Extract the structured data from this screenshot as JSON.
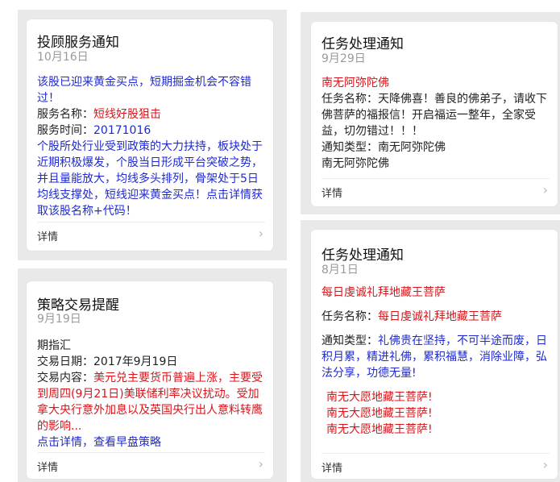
{
  "cards": {
    "c1": {
      "title": "投顾服务通知",
      "date": "10月16日",
      "intro": "该股已迎来黄金买点，短期掘金机会不容错过！",
      "service_name_label": "服务名称：",
      "service_name_value": "短线好股狙击",
      "service_time_label": "服务时间：",
      "service_time_value": "20171016",
      "body": "个股所处行业受到政策的大力扶持，板块处于近期积极爆发，个股当日形成平台突破之势，并且量能放大，均线多头排列，骨架处于5日均线支撑处，短线迎来黄金买点！点击详情获取该股名称+代码！",
      "details": "详情"
    },
    "c2": {
      "title": "任务处理通知",
      "date": "9月29日",
      "first": "南无阿弥陀佛",
      "task_label": "任务名称：",
      "task_value": "天降佛喜！善良的佛弟子，请收下佛菩萨的福报信！开启福运一整年，全家受益，切勿错过！！！",
      "type_label": "通知类型：",
      "type_value": "南无阿弥陀佛",
      "last": "南无阿弥陀佛",
      "details": "详情"
    },
    "c3": {
      "title": "策略交易提醒",
      "date": "9月19日",
      "line1": "期指汇",
      "trade_date_label": "交易日期：",
      "trade_date_value": "2017年9月19日",
      "content_label": "交易内容：",
      "content_value": "美元兑主要货币普遍上涨，主要受到周四(9月21日)美联储利率决议扰动。受加拿大央行意外加息以及英国央行出人意料转鹰的影响...",
      "cta": "点击详情，查看早盘策略",
      "details": "详情"
    },
    "c4": {
      "title": "任务处理通知",
      "date": "8月1日",
      "first": "每日虔诚礼拜地藏王菩萨",
      "task_label": "任务名称：",
      "task_value": "每日虔诚礼拜地藏王菩萨",
      "type_label": "通知类型：",
      "type_value": "礼佛贵在坚持，不可半途而废，日积月累，精进礼佛，累积福慧，消除业障，弘法分享，功德无量!",
      "chant1": "南无大愿地藏王菩萨!",
      "chant2": "南无大愿地藏王菩萨!",
      "chant3": "南无大愿地藏王菩萨!",
      "details": "详情"
    }
  },
  "chevron": "›"
}
